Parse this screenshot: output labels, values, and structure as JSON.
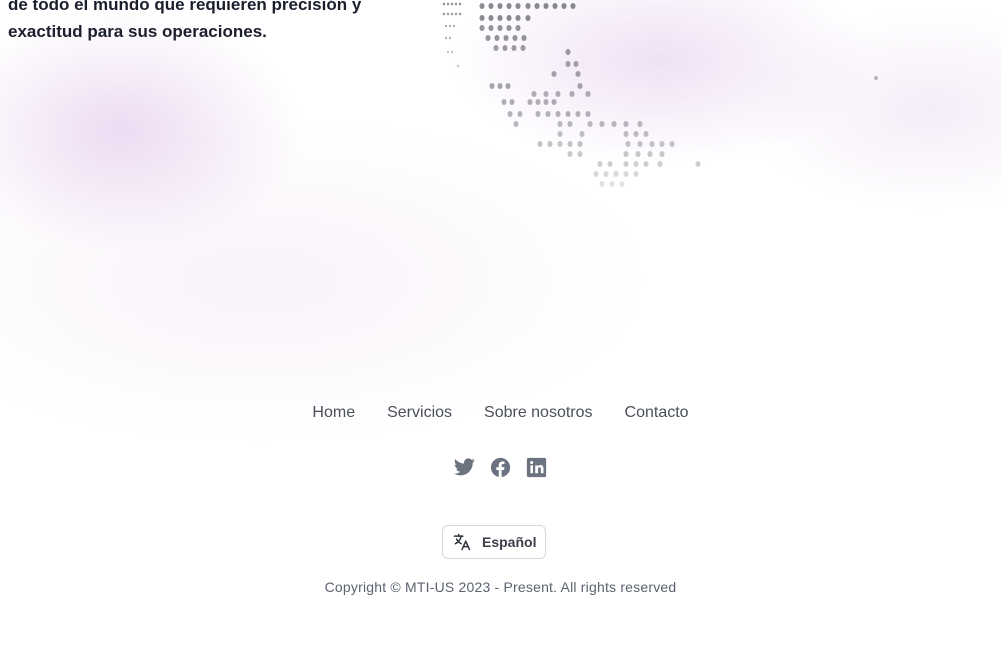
{
  "hero": {
    "text": "de todo el mundo que requieren precisión y exactitud para sus operaciones."
  },
  "footer": {
    "nav": [
      {
        "label": "Home"
      },
      {
        "label": "Servicios"
      },
      {
        "label": "Sobre nosotros"
      },
      {
        "label": "Contacto"
      }
    ],
    "social": [
      {
        "icon": "twitter-icon"
      },
      {
        "icon": "facebook-icon"
      },
      {
        "icon": "linkedin-icon"
      }
    ],
    "language": {
      "icon": "translate-icon",
      "label": "Español"
    },
    "copyright": "Copyright © MTI-US 2023 - Present. All rights reserved"
  },
  "colors": {
    "text_dark": "#1b1e2c",
    "nav_text": "#4a4f5a",
    "icon_gray": "#6b7280",
    "haze": "#e2c8ec"
  }
}
